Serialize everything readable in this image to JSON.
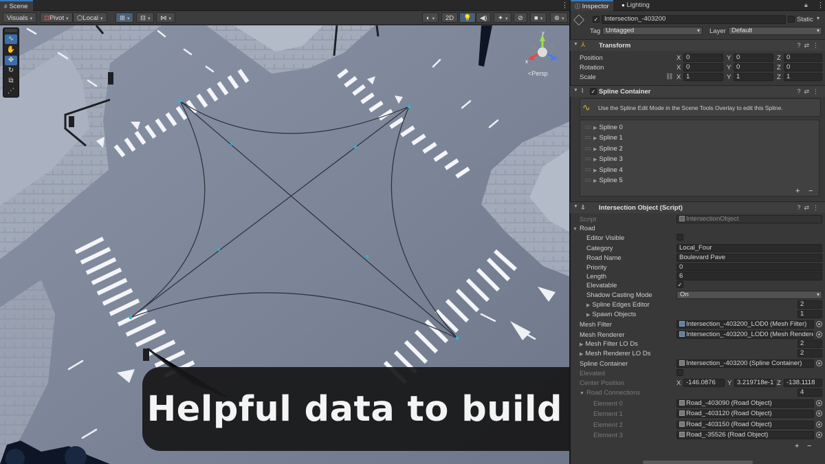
{
  "scene": {
    "tab_label": "Scene",
    "toolbar": {
      "visuals": "Visuals",
      "pivot": "Pivot",
      "local": "Local",
      "mode_2d": "2D"
    },
    "gizmo": {
      "y_label": "y",
      "x_label": "x",
      "persp_label": "<Persp"
    },
    "overlay_text": "Helpful data to build upon"
  },
  "inspector": {
    "tabs": [
      "Inspector",
      "Lighting"
    ],
    "object": {
      "name": "Intersection_-403200",
      "static_label": "Static",
      "tag_label": "Tag",
      "tag_value": "Untagged",
      "layer_label": "Layer",
      "layer_value": "Default"
    },
    "transform": {
      "title": "Transform",
      "rows": [
        {
          "label": "Position",
          "x": "0",
          "y": "0",
          "z": "0"
        },
        {
          "label": "Rotation",
          "x": "0",
          "y": "0",
          "z": "0"
        },
        {
          "label": "Scale",
          "x": "1",
          "y": "1",
          "z": "1"
        }
      ],
      "axis_x": "X",
      "axis_y": "Y",
      "axis_z": "Z"
    },
    "spline_container": {
      "title": "Spline Container",
      "info": "Use the Spline Edit Mode in the Scene Tools Overlay to edit this Spline.",
      "splines": [
        "Spline 0",
        "Spline 1",
        "Spline 2",
        "Spline 3",
        "Spline 4",
        "Spline 5"
      ],
      "plus": "+",
      "minus": "−"
    },
    "intersection": {
      "title": "Intersection Object (Script)",
      "script_label": "Script",
      "script_value": "IntersectionObject",
      "road_label": "Road",
      "editor_visible": "Editor Visible",
      "category_label": "Category",
      "category_value": "Local_Four",
      "road_name_label": "Road Name",
      "road_name_value": "Boulevard Pave",
      "priority_label": "Priority",
      "priority_value": "0",
      "length_label": "Length",
      "length_value": "6",
      "elevatable_label": "Elevatable",
      "shadow_label": "Shadow Casting Mode",
      "shadow_value": "On",
      "spline_edges_label": "Spline Edges Editor",
      "spline_edges_value": "2",
      "spawn_label": "Spawn Objects",
      "spawn_value": "1",
      "mesh_filter_label": "Mesh Filter",
      "mesh_filter_value": "Intersection_-403200_LOD0 (Mesh Filter)",
      "mesh_renderer_label": "Mesh Renderer",
      "mesh_renderer_value": "Intersection_-403200_LOD0 (Mesh Renderer)",
      "mf_lods_label": "Mesh Filter LO Ds",
      "mf_lods_value": "2",
      "mr_lods_label": "Mesh Renderer LO Ds",
      "mr_lods_value": "2",
      "spline_container_label": "Spline Container",
      "spline_container_value": "Intersection_-403200 (Spline Container)",
      "elevated_label": "Elevated",
      "center_label": "Center Position",
      "center_x": "-146.0876",
      "center_y": "3.219718e-17",
      "center_z": "-138.1118",
      "road_connections_label": "Road Connections",
      "road_connections_count": "4",
      "connections": [
        {
          "label": "Element 0",
          "value": "Road_-403090 (Road Object)"
        },
        {
          "label": "Element 1",
          "value": "Road_-403120 (Road Object)"
        },
        {
          "label": "Element 2",
          "value": "Road_-403150 (Road Object)"
        },
        {
          "label": "Element 3",
          "value": "Road_-35526 (Road Object)"
        }
      ]
    }
  }
}
